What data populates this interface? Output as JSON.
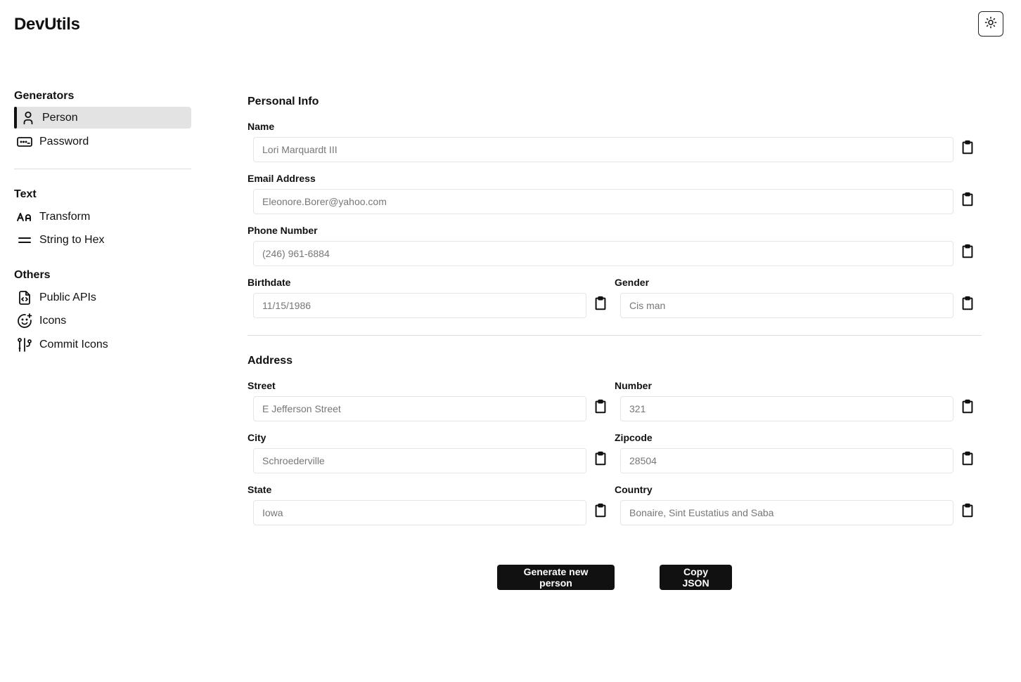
{
  "app": {
    "title": "DevUtils"
  },
  "sidebar": {
    "sections": [
      {
        "title": "Generators",
        "items": [
          {
            "label": "Person",
            "icon": "user-icon",
            "active": true
          },
          {
            "label": "Password",
            "icon": "password-icon",
            "active": false
          }
        ]
      },
      {
        "title": "Text",
        "items": [
          {
            "label": "Transform",
            "icon": "text-case-icon",
            "active": false
          },
          {
            "label": "String to Hex",
            "icon": "equals-icon",
            "active": false
          }
        ]
      },
      {
        "title": "Others",
        "items": [
          {
            "label": "Public APIs",
            "icon": "file-code-icon",
            "active": false
          },
          {
            "label": "Icons",
            "icon": "mood-plus-icon",
            "active": false
          },
          {
            "label": "Commit Icons",
            "icon": "git-commit-icon",
            "active": false
          }
        ]
      }
    ]
  },
  "personal_info": {
    "title": "Personal Info",
    "name": {
      "label": "Name",
      "value": "Lori Marquardt III"
    },
    "email": {
      "label": "Email Address",
      "value": "Eleonore.Borer@yahoo.com"
    },
    "phone": {
      "label": "Phone Number",
      "value": "(246) 961-6884"
    },
    "birthdate": {
      "label": "Birthdate",
      "value": "11/15/1986"
    },
    "gender": {
      "label": "Gender",
      "value": "Cis man"
    }
  },
  "address": {
    "title": "Address",
    "street": {
      "label": "Street",
      "value": "E Jefferson Street"
    },
    "number": {
      "label": "Number",
      "value": "321"
    },
    "city": {
      "label": "City",
      "value": "Schroederville"
    },
    "zipcode": {
      "label": "Zipcode",
      "value": "28504"
    },
    "state": {
      "label": "State",
      "value": "Iowa"
    },
    "country": {
      "label": "Country",
      "value": "Bonaire, Sint Eustatius and Saba"
    }
  },
  "actions": {
    "generate_label": "Generate new person",
    "copy_json_label": "Copy JSON"
  }
}
